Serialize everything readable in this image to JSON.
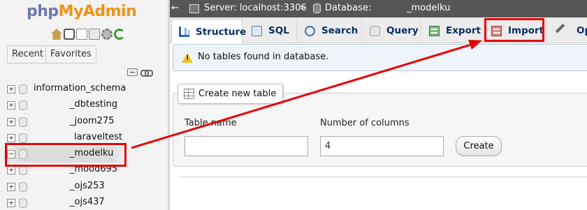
{
  "sidebar": {
    "logo_php": "php",
    "logo_myadmin": "MyAdmin",
    "icons": [
      "home-icon",
      "exit-icon",
      "docs-icon",
      "docs-alt-icon",
      "settings-gear-icon",
      "reload-icon"
    ],
    "tabs": {
      "recent": "Recent",
      "favorites": "Favorites"
    },
    "databases": [
      {
        "name": "information_schema",
        "toggle": "+"
      },
      {
        "name": "_dbtesting",
        "toggle": "+"
      },
      {
        "name": "_joom275",
        "toggle": "+"
      },
      {
        "name": "laraveltest",
        "toggle": "+"
      },
      {
        "name": "_modelku",
        "toggle": "−"
      },
      {
        "name": "_mood695",
        "toggle": "+"
      },
      {
        "name": "_ojs253",
        "toggle": "+"
      },
      {
        "name": "_ojs437",
        "toggle": "+"
      }
    ]
  },
  "breadcrumb": {
    "back": "←",
    "server": "Server: localhost:3306",
    "separator": "»",
    "database_label": "Database:",
    "database_name": "_modelku"
  },
  "tabs": [
    {
      "label": "Structure",
      "icon": "structure-icon"
    },
    {
      "label": "SQL",
      "icon": "sql-icon"
    },
    {
      "label": "Search",
      "icon": "search-icon"
    },
    {
      "label": "Query",
      "icon": "query-icon"
    },
    {
      "label": "Export",
      "icon": "export-icon"
    },
    {
      "label": "Import",
      "icon": "import-icon"
    },
    {
      "label": "Ope",
      "icon": "operations-wrench-icon"
    }
  ],
  "notice": {
    "message": "No tables found in database.",
    "icon": "warning-icon"
  },
  "create_table": {
    "legend": "Create new table",
    "table_name_label": "Table name",
    "table_name_value": "",
    "num_columns_label": "Number of columns",
    "num_columns_value": "4",
    "create_button": "Create"
  },
  "annotation_color": "#e60000"
}
